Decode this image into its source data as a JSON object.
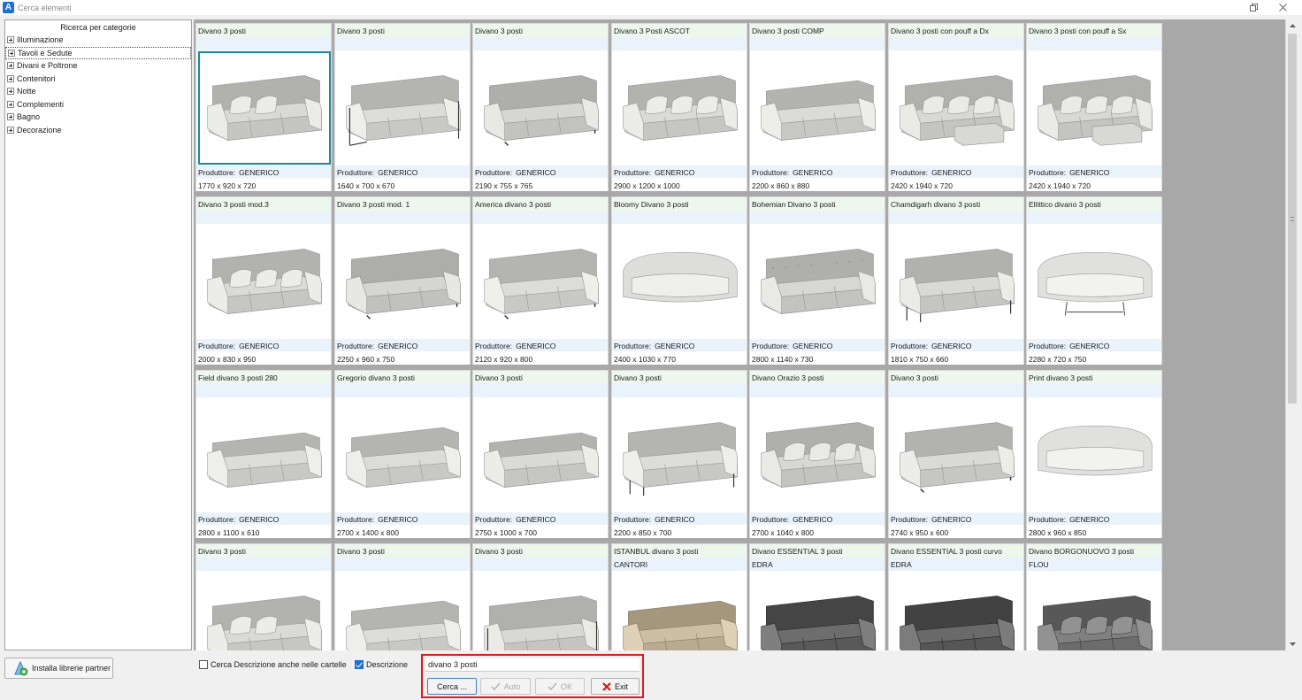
{
  "window": {
    "title": "Cerca elementi",
    "app_icon_letter": "A"
  },
  "sidebar": {
    "title": "Ricerca per categorie",
    "items": [
      {
        "label": "Illuminazione"
      },
      {
        "label": "Tavoli e Sedute"
      },
      {
        "label": "Divani e Poltrone"
      },
      {
        "label": "Contenitori"
      },
      {
        "label": "Notte"
      },
      {
        "label": "Complementi"
      },
      {
        "label": "Bagno"
      },
      {
        "label": "Decorazione"
      }
    ],
    "selected_index": 1
  },
  "grid": {
    "producer_label": "Produttore:",
    "selected_index": 0,
    "items": [
      {
        "name": "Divano 3 posti",
        "brand": "",
        "producer": "GENERICO",
        "dims": "1770 x 920 x 720",
        "color": "#d9d9d6",
        "style": "pillows2"
      },
      {
        "name": "Divano 3 posti",
        "brand": "",
        "producer": "GENERICO",
        "dims": "1640 x 700 x 670",
        "color": "#dcdcd9",
        "style": "frame"
      },
      {
        "name": "Divano 3 posti",
        "brand": "",
        "producer": "GENERICO",
        "dims": "2190 x 755 x 765",
        "color": "#d6d6d3",
        "style": "box"
      },
      {
        "name": "Divano 3 Posti ASCOT",
        "brand": "",
        "producer": "GENERICO",
        "dims": "2900 x 1200 x 1000",
        "color": "#dadad7",
        "style": "pillows3"
      },
      {
        "name": "Divano 3 posti COMP",
        "brand": "",
        "producer": "GENERICO",
        "dims": "2200 x 860 x 880",
        "color": "#dbdbd8",
        "style": "lowback"
      },
      {
        "name": "Divano 3 posti con pouff a Dx",
        "brand": "",
        "producer": "GENERICO",
        "dims": "2420 x 1940 x 720",
        "color": "#d8d8d5",
        "style": "pouf"
      },
      {
        "name": "Divano 3 posti con pouff a Sx",
        "brand": "",
        "producer": "GENERICO",
        "dims": "2420 x 1940 x 720",
        "color": "#d8d8d5",
        "style": "pouf"
      },
      {
        "name": "Divano 3 posti mod.3",
        "brand": "",
        "producer": "GENERICO",
        "dims": "2000 x 830 x 950",
        "color": "#dadad7",
        "style": "classic"
      },
      {
        "name": "Divano 3 posti mod. 1",
        "brand": "",
        "producer": "GENERICO",
        "dims": "2250 x 960 x 750",
        "color": "#d5d5d2",
        "style": "box"
      },
      {
        "name": "America divano 3 posti",
        "brand": "",
        "producer": "GENERICO",
        "dims": "2120 x 920 x 800",
        "color": "#dcdcd9",
        "style": "box"
      },
      {
        "name": "Bloomy Divano 3 posti",
        "brand": "",
        "producer": "GENERICO",
        "dims": "2400 x 1030 x 770",
        "color": "#dddddb",
        "style": "round"
      },
      {
        "name": "Bohemian Divano 3 posti",
        "brand": "",
        "producer": "GENERICO",
        "dims": "2800 x 1140 x 730",
        "color": "#d7d7d4",
        "style": "chester"
      },
      {
        "name": "Chamdigarh divano 3 posti",
        "brand": "",
        "producer": "GENERICO",
        "dims": "1810 x 750 x 660",
        "color": "#d9d9d6",
        "style": "legs"
      },
      {
        "name": "Ellittico divano 3 posti",
        "brand": "",
        "producer": "GENERICO",
        "dims": "2280 x 720 x 750",
        "color": "#e0e0de",
        "style": "ellipse"
      },
      {
        "name": "Field divano 3 posti 280",
        "brand": "",
        "producer": "GENERICO",
        "dims": "2800 x 1100 x 610",
        "color": "#dcdcd9",
        "style": "lowbox"
      },
      {
        "name": "Gregorio divano 3 posti",
        "brand": "",
        "producer": "GENERICO",
        "dims": "2700 x 1400 x 800",
        "color": "#dcdcd9",
        "style": "lowback"
      },
      {
        "name": "Divano 3 posti",
        "brand": "",
        "producer": "GENERICO",
        "dims": "2750 x 1000 x 700",
        "color": "#dadad7",
        "style": "lowbox"
      },
      {
        "name": "Divano 3 posti",
        "brand": "",
        "producer": "GENERICO",
        "dims": "2200 x 850 x 700",
        "color": "#dcdcd9",
        "style": "legs"
      },
      {
        "name": "Divano Orazio 3 posti",
        "brand": "",
        "producer": "GENERICO",
        "dims": "2700 x 1040 x 800",
        "color": "#d7d7d4",
        "style": "pillows3"
      },
      {
        "name": "Divano 3 posti",
        "brand": "",
        "producer": "GENERICO",
        "dims": "2740 x 950 x 600",
        "color": "#dadad7",
        "style": "box"
      },
      {
        "name": "Print divano 3 posti",
        "brand": "",
        "producer": "GENERICO",
        "dims": "2800 x 960 x 850",
        "color": "#e0e0de",
        "style": "round"
      },
      {
        "name": "Divano 3 posti",
        "brand": "",
        "producer": "",
        "dims": "",
        "color": "#dadad7",
        "style": "pillows2"
      },
      {
        "name": "Divano 3 posti",
        "brand": "",
        "producer": "",
        "dims": "",
        "color": "#dcdcd9",
        "style": "lowback"
      },
      {
        "name": "Divano 3 posti",
        "brand": "",
        "producer": "",
        "dims": "",
        "color": "#d8d8d5",
        "style": "frame"
      },
      {
        "name": "ISTANBUL divano 3 posti",
        "brand": "CANTORI",
        "producer": "",
        "dims": "",
        "color": "#cdbfa5",
        "style": "lowback"
      },
      {
        "name": "Divano ESSENTIAL 3 posti",
        "brand": "EDRA",
        "producer": "",
        "dims": "",
        "color": "#6d6d6d",
        "style": "box"
      },
      {
        "name": "Divano ESSENTIAL 3 posti curvo",
        "brand": "EDRA",
        "producer": "",
        "dims": "",
        "color": "#6a6a6a",
        "style": "box"
      },
      {
        "name": "Divano BORGONUOVO 3 posti",
        "brand": "FLOU",
        "producer": "",
        "dims": "",
        "color": "#808080",
        "style": "pillows3"
      }
    ]
  },
  "bottom": {
    "partner_button": "Installa librerie partner",
    "search_in_folders_label": "Cerca Descrizione anche nelle cartelle",
    "search_in_folders_checked": false,
    "description_label": "Descrizione",
    "description_checked": true,
    "search_value": "divano 3 posti",
    "search_button": "Cerca ...",
    "auto_button": "Auto",
    "ok_button": "OK",
    "exit_button": "Exit"
  },
  "colors": {
    "highlight_frame": "#e01a1a",
    "selection_border": "#1a8a9a",
    "grid_background": "#a8a8a8"
  }
}
